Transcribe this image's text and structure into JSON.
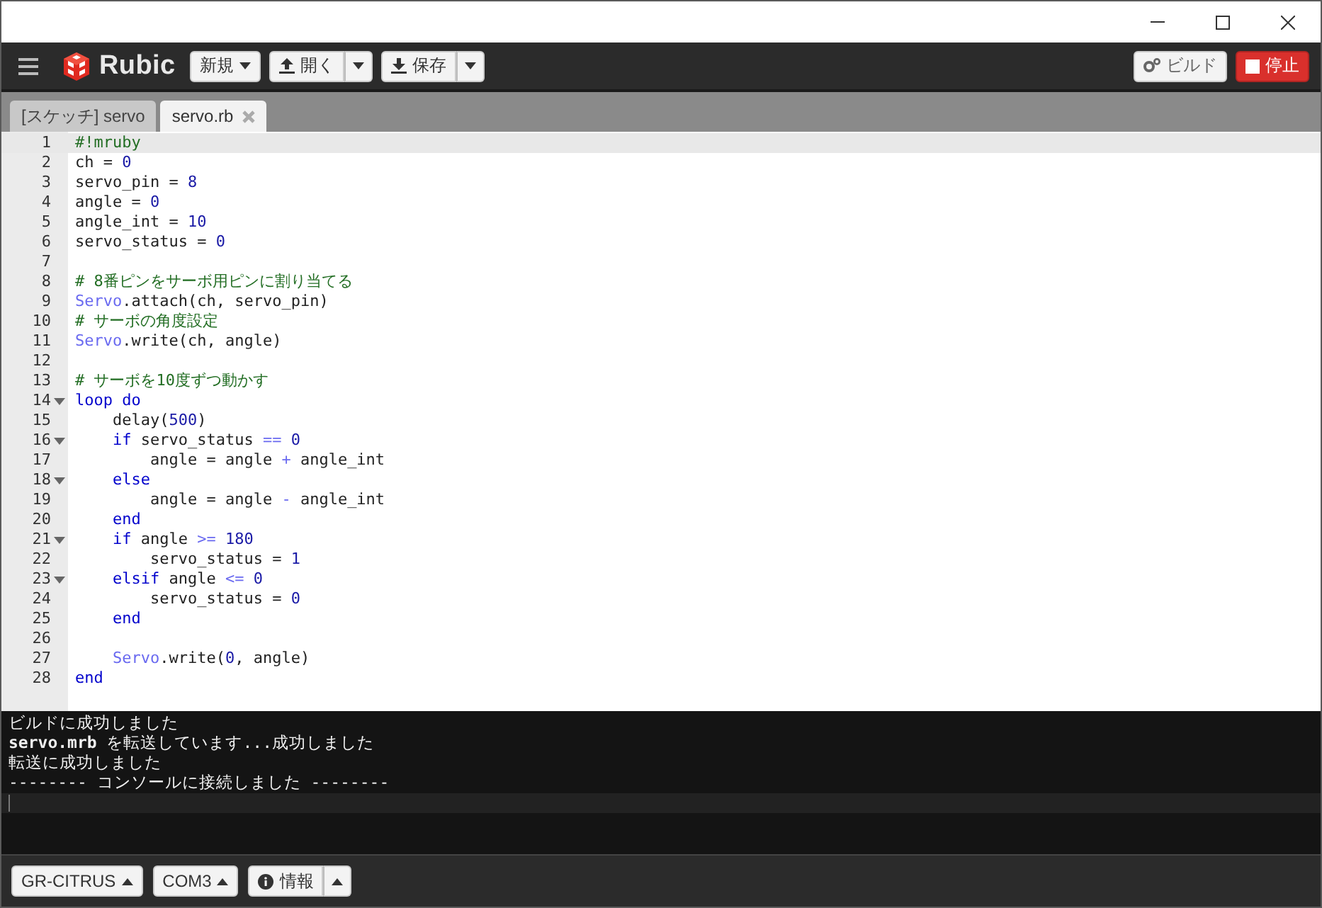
{
  "toolbar": {
    "app_name": "Rubic",
    "buttons": [
      {
        "label": "新規",
        "split": false
      },
      {
        "label": "開く",
        "split": true
      },
      {
        "label": "保存",
        "split": true
      }
    ],
    "build_button": "ビルド",
    "stop_button": "停止"
  },
  "tabs": [
    {
      "label": "[スケッチ] servo",
      "selected": false,
      "closable": false
    },
    {
      "label": "servo.rb",
      "selected": true,
      "closable": true
    }
  ],
  "editor": {
    "lines": [
      {
        "number": "1",
        "fold": false,
        "active": true,
        "tokens": [
          {
            "t": "#!mruby",
            "kind": "comment"
          }
        ]
      },
      {
        "number": "2",
        "fold": false,
        "active": false,
        "tokens": [
          {
            "t": "ch = ",
            "kind": "plain"
          },
          {
            "t": "0",
            "kind": "number"
          }
        ]
      },
      {
        "number": "3",
        "fold": false,
        "active": false,
        "tokens": [
          {
            "t": "servo_pin = ",
            "kind": "plain"
          },
          {
            "t": "8",
            "kind": "number"
          }
        ]
      },
      {
        "number": "4",
        "fold": false,
        "active": false,
        "tokens": [
          {
            "t": "angle = ",
            "kind": "plain"
          },
          {
            "t": "0",
            "kind": "number"
          }
        ]
      },
      {
        "number": "5",
        "fold": false,
        "active": false,
        "tokens": [
          {
            "t": "angle_int = ",
            "kind": "plain"
          },
          {
            "t": "10",
            "kind": "number"
          }
        ]
      },
      {
        "number": "6",
        "fold": false,
        "active": false,
        "tokens": [
          {
            "t": "servo_status = ",
            "kind": "plain"
          },
          {
            "t": "0",
            "kind": "number"
          }
        ]
      },
      {
        "number": "7",
        "fold": false,
        "active": false
      },
      {
        "number": "8",
        "fold": false,
        "active": false,
        "tokens": [
          {
            "t": "# 8番ピンをサーボ用ピンに割り当てる",
            "kind": "comment"
          }
        ]
      },
      {
        "number": "9",
        "fold": false,
        "active": false,
        "tokens": [
          {
            "t": "Servo",
            "kind": "const"
          },
          {
            "t": ".attach(ch, servo_pin)",
            "kind": "plain"
          }
        ]
      },
      {
        "number": "10",
        "fold": false,
        "active": false,
        "tokens": [
          {
            "t": "# サーボの角度設定",
            "kind": "comment"
          }
        ]
      },
      {
        "number": "11",
        "fold": false,
        "active": false,
        "tokens": [
          {
            "t": "Servo",
            "kind": "const"
          },
          {
            "t": ".write(ch, angle)",
            "kind": "plain"
          }
        ]
      },
      {
        "number": "12",
        "fold": false,
        "active": false
      },
      {
        "number": "13",
        "fold": false,
        "active": false,
        "tokens": [
          {
            "t": "# サーボを10度ずつ動かす",
            "kind": "comment"
          }
        ]
      },
      {
        "number": "14",
        "fold": true,
        "active": false,
        "tokens": [
          {
            "t": "loop do",
            "kind": "keyword"
          }
        ]
      },
      {
        "number": "15",
        "fold": false,
        "active": false,
        "tokens": [
          {
            "t": "    delay(",
            "kind": "plain"
          },
          {
            "t": "500",
            "kind": "number"
          },
          {
            "t": ")",
            "kind": "plain"
          }
        ]
      },
      {
        "number": "16",
        "fold": true,
        "active": false,
        "tokens": [
          {
            "t": "    if",
            "kind": "keyword"
          },
          {
            "t": " servo_status ",
            "kind": "plain"
          },
          {
            "t": "== ",
            "kind": "operator"
          },
          {
            "t": "0",
            "kind": "number"
          }
        ]
      },
      {
        "number": "17",
        "fold": false,
        "active": false,
        "tokens": [
          {
            "t": "        angle = angle ",
            "kind": "plain"
          },
          {
            "t": "+",
            "kind": "operator"
          },
          {
            "t": " angle_int",
            "kind": "plain"
          }
        ]
      },
      {
        "number": "18",
        "fold": true,
        "active": false,
        "tokens": [
          {
            "t": "    else",
            "kind": "keyword"
          }
        ]
      },
      {
        "number": "19",
        "fold": false,
        "active": false,
        "tokens": [
          {
            "t": "        angle = angle ",
            "kind": "plain"
          },
          {
            "t": "-",
            "kind": "operator"
          },
          {
            "t": " angle_int",
            "kind": "plain"
          }
        ]
      },
      {
        "number": "20",
        "fold": false,
        "active": false,
        "tokens": [
          {
            "t": "    end",
            "kind": "keyword"
          }
        ]
      },
      {
        "number": "21",
        "fold": true,
        "active": false,
        "tokens": [
          {
            "t": "    if",
            "kind": "keyword"
          },
          {
            "t": " angle ",
            "kind": "plain"
          },
          {
            "t": ">= ",
            "kind": "operator"
          },
          {
            "t": "180",
            "kind": "number"
          }
        ]
      },
      {
        "number": "22",
        "fold": false,
        "active": false,
        "tokens": [
          {
            "t": "        servo_status = ",
            "kind": "plain"
          },
          {
            "t": "1",
            "kind": "number"
          }
        ]
      },
      {
        "number": "23",
        "fold": true,
        "active": false,
        "tokens": [
          {
            "t": "    elsif",
            "kind": "keyword"
          },
          {
            "t": " angle ",
            "kind": "plain"
          },
          {
            "t": "<= ",
            "kind": "operator"
          },
          {
            "t": "0",
            "kind": "number"
          }
        ]
      },
      {
        "number": "24",
        "fold": false,
        "active": false,
        "tokens": [
          {
            "t": "        servo_status = ",
            "kind": "plain"
          },
          {
            "t": "0",
            "kind": "number"
          }
        ]
      },
      {
        "number": "25",
        "fold": false,
        "active": false,
        "tokens": [
          {
            "t": "    end",
            "kind": "keyword"
          }
        ]
      },
      {
        "number": "26",
        "fold": false,
        "active": false
      },
      {
        "number": "27",
        "fold": false,
        "active": false,
        "tokens": [
          {
            "t": "    Servo",
            "kind": "const"
          },
          {
            "t": ".write(",
            "kind": "plain"
          },
          {
            "t": "0",
            "kind": "number"
          },
          {
            "t": ", angle)",
            "kind": "plain"
          }
        ]
      },
      {
        "number": "28",
        "fold": false,
        "active": false,
        "tokens": [
          {
            "t": "end",
            "kind": "keyword"
          }
        ]
      }
    ]
  },
  "console": {
    "lines": [
      "ビルドに成功しました",
      "**servo.mrb** を転送しています...成功しました",
      "転送に成功しました",
      "-------- コンソールに接続しました --------"
    ]
  },
  "status_bar": {
    "board": "GR-CITRUS",
    "port": "COM3",
    "info": "情報"
  }
}
